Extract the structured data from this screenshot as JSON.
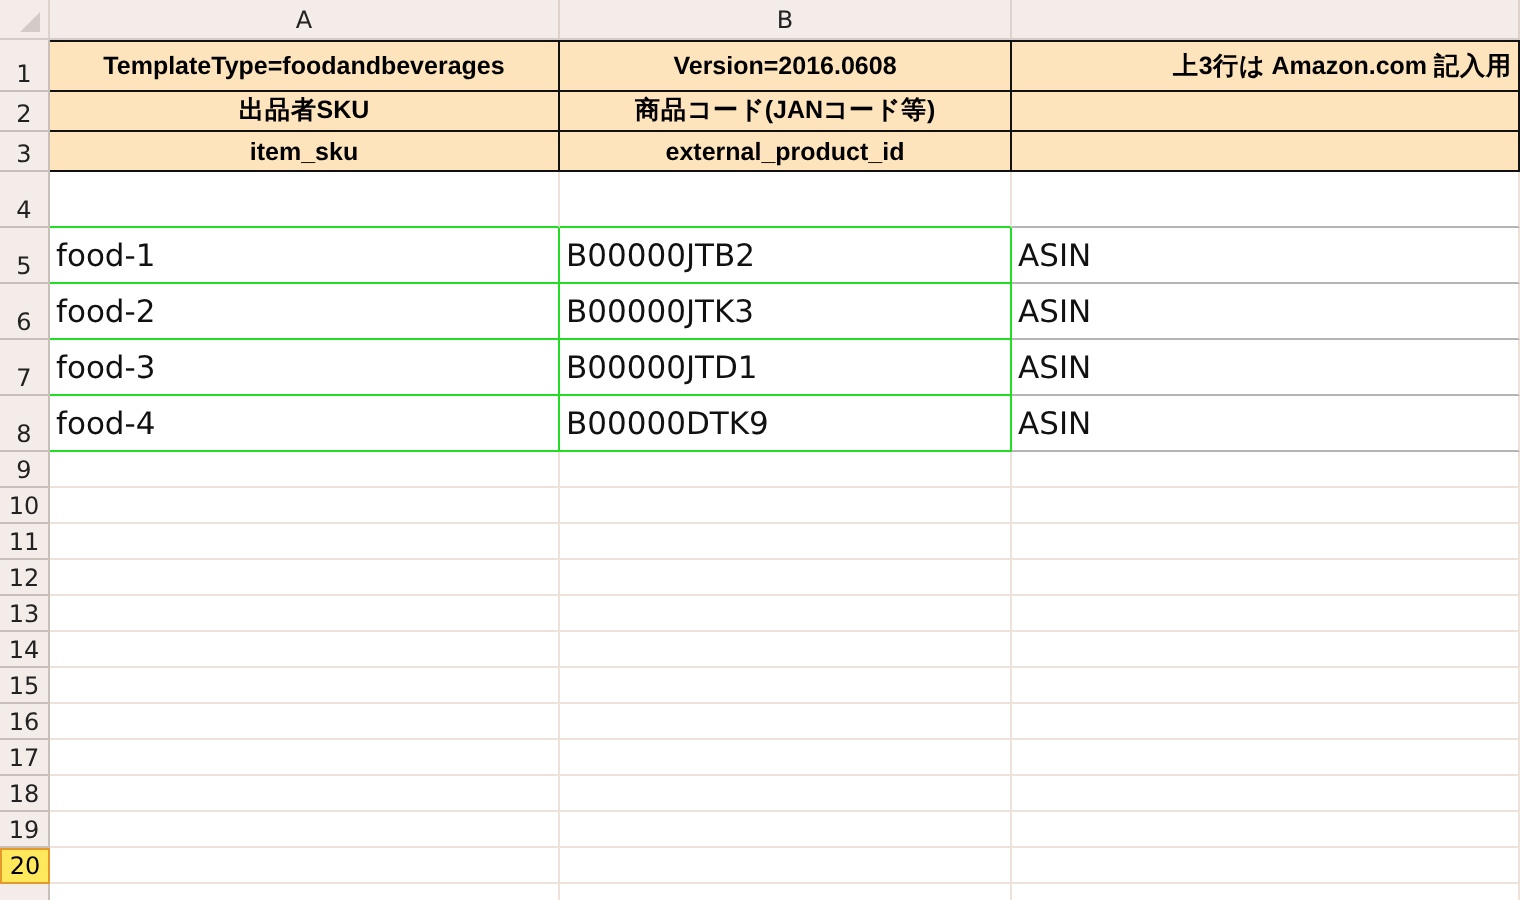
{
  "columns": [
    {
      "label": "A"
    },
    {
      "label": "B"
    },
    {}
  ],
  "rows": [
    {
      "number": "1",
      "kind": "title",
      "selected": false,
      "cells": [
        "TemplateType=foodandbeverages",
        "Version=2016.0608",
        "上3行は Amazon.com 記入用"
      ]
    },
    {
      "number": "2",
      "kind": "header",
      "selected": false,
      "cells": [
        "出品者SKU",
        "商品コード(JANコード等)"
      ]
    },
    {
      "number": "3",
      "kind": "header",
      "selected": false,
      "cells": [
        "item_sku",
        "external_product_id"
      ]
    },
    {
      "number": "4",
      "kind": "blank",
      "selected": false,
      "cells": []
    },
    {
      "number": "5",
      "kind": "data",
      "selected": false,
      "cells": [
        "food-1",
        "B00000JTB2",
        "ASIN"
      ]
    },
    {
      "number": "6",
      "kind": "data",
      "selected": false,
      "cells": [
        "food-2",
        "B00000JTK3",
        "ASIN"
      ]
    },
    {
      "number": "7",
      "kind": "data",
      "selected": false,
      "cells": [
        "food-3",
        "B00000JTD1",
        "ASIN"
      ]
    },
    {
      "number": "8",
      "kind": "data",
      "selected": false,
      "cells": [
        "food-4",
        "B00000DTK9",
        "ASIN"
      ]
    },
    {
      "number": "9",
      "kind": "empty",
      "selected": false,
      "cells": []
    },
    {
      "number": "10",
      "kind": "empty",
      "selected": false,
      "cells": []
    },
    {
      "number": "11",
      "kind": "empty",
      "selected": false,
      "cells": []
    },
    {
      "number": "12",
      "kind": "empty",
      "selected": false,
      "cells": []
    },
    {
      "number": "13",
      "kind": "empty",
      "selected": false,
      "cells": []
    },
    {
      "number": "14",
      "kind": "empty",
      "selected": false,
      "cells": []
    },
    {
      "number": "15",
      "kind": "empty",
      "selected": false,
      "cells": []
    },
    {
      "number": "16",
      "kind": "empty",
      "selected": false,
      "cells": []
    },
    {
      "number": "17",
      "kind": "empty",
      "selected": false,
      "cells": []
    },
    {
      "number": "18",
      "kind": "empty",
      "selected": false,
      "cells": []
    },
    {
      "number": "19",
      "kind": "empty",
      "selected": false,
      "cells": []
    },
    {
      "number": "20",
      "kind": "empty",
      "selected": true,
      "cells": []
    }
  ]
}
